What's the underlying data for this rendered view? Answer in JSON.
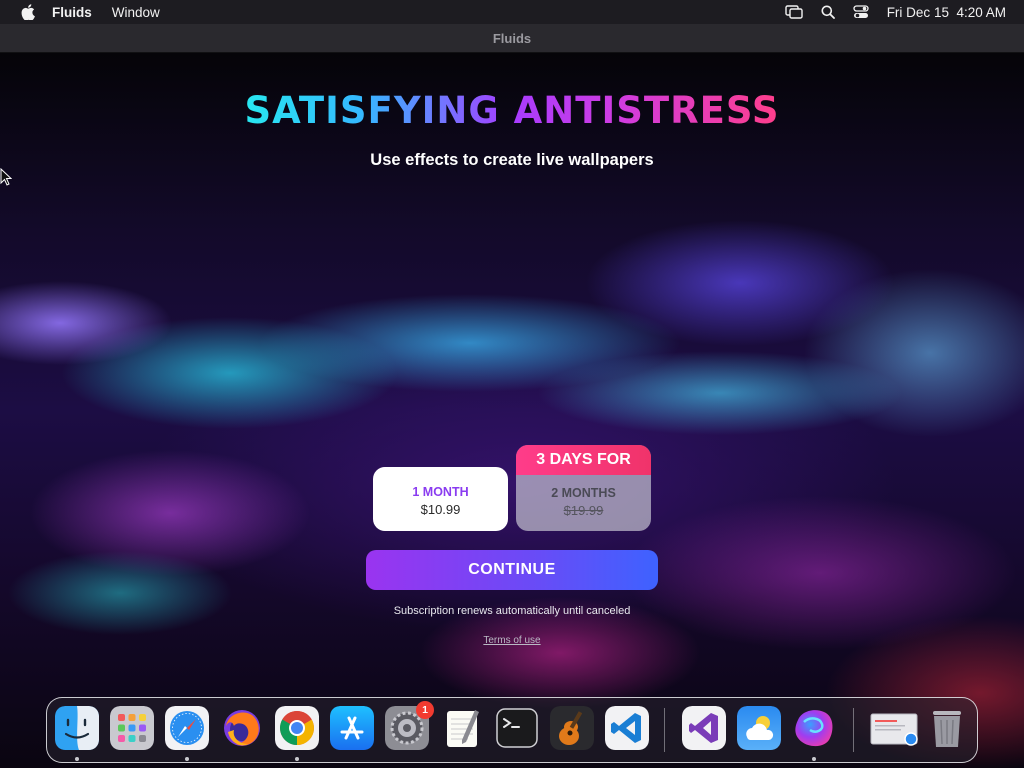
{
  "menubar": {
    "app_name": "Fluids",
    "menus": [
      "Window"
    ],
    "datetime": "Fri Dec 15  4:20 AM",
    "icons": [
      "apple-logo",
      "screen-mirroring-icon",
      "search-icon",
      "control-center-icon"
    ]
  },
  "window": {
    "title": "Fluids"
  },
  "paywall": {
    "headline": "SATISFYING ANTISTRESS",
    "subtitle": "Use effects to create live wallpapers",
    "plans": [
      {
        "name": "1 MONTH",
        "price": "$10.99",
        "selected": true
      },
      {
        "banner": "3 DAYS FOR",
        "name": "2 MONTHS",
        "price": "$19.99",
        "strikethrough": true,
        "selected": false
      }
    ],
    "continue_label": "CONTINUE",
    "renewal_note": "Subscription renews automatically until canceled",
    "terms_label": "Terms of use",
    "colors": {
      "accent_purple": "#8a3cf0",
      "button_gradient_start": "#9a34f0",
      "button_gradient_end": "#3e62ff",
      "trial_banner": "#ff3c8a"
    }
  },
  "dock": {
    "apps": [
      {
        "name": "Finder",
        "icon": "finder-icon",
        "running": true
      },
      {
        "name": "Launchpad",
        "icon": "launchpad-icon",
        "running": false
      },
      {
        "name": "Safari",
        "icon": "safari-icon",
        "running": true
      },
      {
        "name": "Firefox",
        "icon": "firefox-icon",
        "running": false
      },
      {
        "name": "Google Chrome",
        "icon": "chrome-icon",
        "running": true
      },
      {
        "name": "App Store",
        "icon": "app-store-icon",
        "running": false
      },
      {
        "name": "System Settings",
        "icon": "system-settings-icon",
        "running": false,
        "badge": "1"
      },
      {
        "name": "TextEdit",
        "icon": "textedit-icon",
        "running": false
      },
      {
        "name": "Terminal",
        "icon": "terminal-icon",
        "running": false
      },
      {
        "name": "GarageBand",
        "icon": "garageband-icon",
        "running": false
      },
      {
        "name": "Visual Studio Code",
        "icon": "vscode-icon",
        "running": false
      },
      {
        "name": "Visual Studio",
        "icon": "visual-studio-icon",
        "running": false
      },
      {
        "name": "Weather",
        "icon": "weather-icon",
        "running": false
      },
      {
        "name": "Fluids",
        "icon": "fluids-icon",
        "running": true
      },
      {
        "name": "Preview",
        "icon": "preview-icon",
        "running": false
      },
      {
        "name": "Trash",
        "icon": "trash-icon",
        "running": false
      }
    ]
  }
}
